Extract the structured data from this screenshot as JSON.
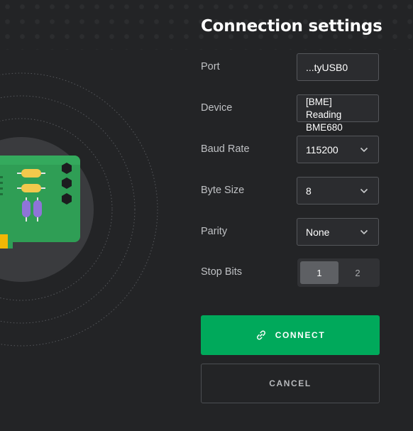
{
  "title": "Connection settings",
  "fields": {
    "port": {
      "label": "Port",
      "value": "...tyUSB0"
    },
    "device": {
      "label": "Device",
      "value_line1": "[BME] Reading",
      "value_line2": "BME680"
    },
    "baud_rate": {
      "label": "Baud Rate",
      "value": "115200"
    },
    "byte_size": {
      "label": "Byte Size",
      "value": "8"
    },
    "parity": {
      "label": "Parity",
      "value": "None"
    },
    "stop_bits": {
      "label": "Stop Bits",
      "options": [
        "1",
        "2"
      ],
      "selected": "1"
    }
  },
  "buttons": {
    "connect": "CONNECT",
    "cancel": "CANCEL"
  },
  "colors": {
    "background": "#232426",
    "accent": "#00a95b",
    "field_bg": "#2b2c2f"
  },
  "icons": {
    "connect": "link-icon",
    "dropdown": "chevron-down-icon"
  }
}
